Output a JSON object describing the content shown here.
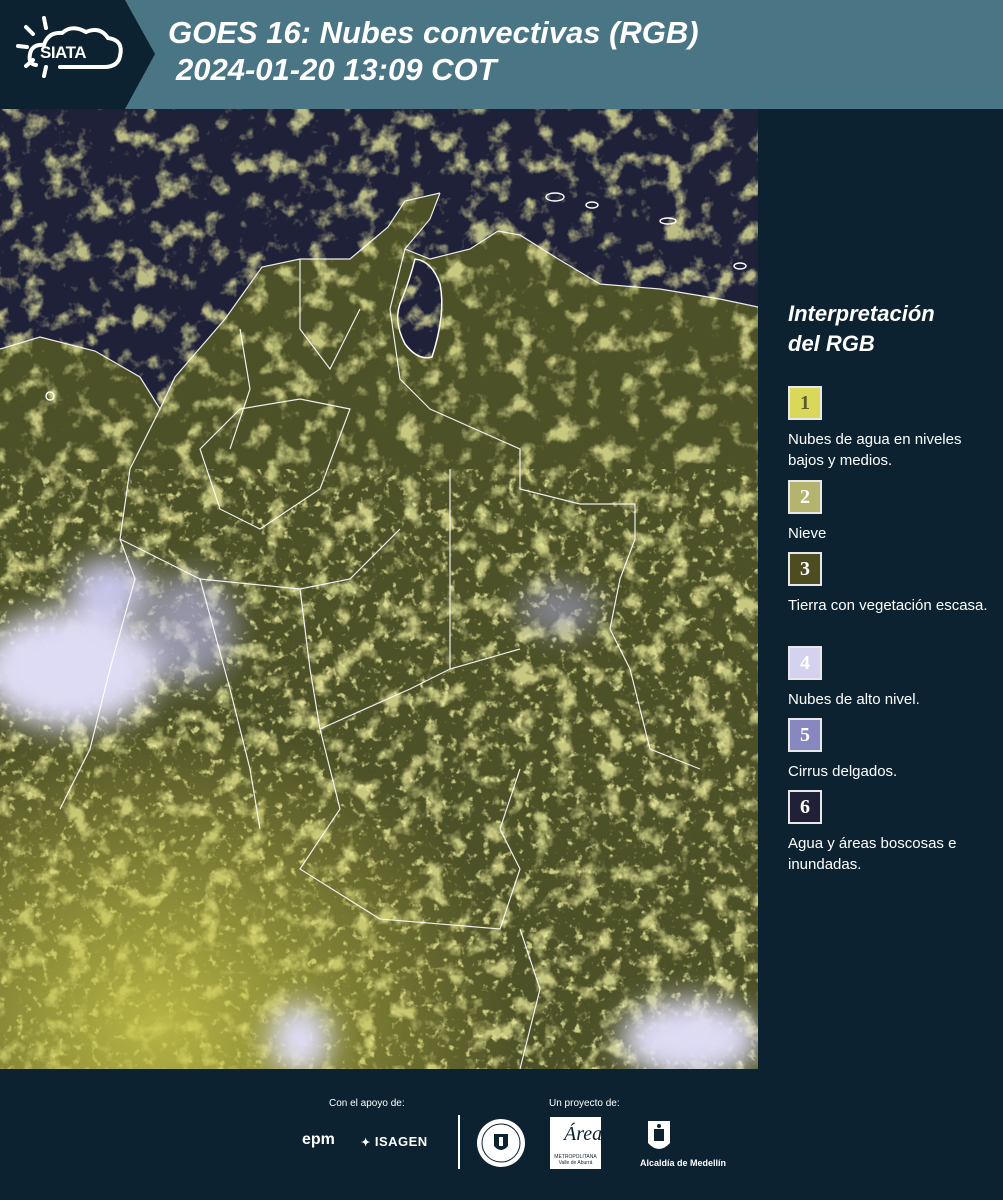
{
  "header": {
    "logo_text": "SIATA",
    "title_line1": "GOES 16: Nubes convectivas (RGB)",
    "title_line2": "2024-01-20 13:09 COT"
  },
  "map": {
    "icon": "satellite-image",
    "colors": {
      "ocean": "#1f2139",
      "land": "#4d5127",
      "low_clouds": "#e4e05a",
      "high_clouds": "#dcdcf2",
      "borders": "#ffffff"
    }
  },
  "legend": {
    "title_line1": "Interpretación",
    "title_line2": "del RGB",
    "items": [
      {
        "number": "1",
        "color": "#dad85a",
        "text_color": "#5a5a2a",
        "description": "Nubes de agua en niveles bajos y medios."
      },
      {
        "number": "2",
        "color": "#b4b46e",
        "text_color": "#ffffff",
        "description": "Nieve"
      },
      {
        "number": "3",
        "color": "#4e4d22",
        "text_color": "#ffffff",
        "description": "Tierra con vegetación escasa."
      },
      {
        "number": "4",
        "color": "#d4d2ef",
        "text_color": "#ffffff",
        "description": "Nubes de alto nivel."
      },
      {
        "number": "5",
        "color": "#8888c0",
        "text_color": "#ffffff",
        "description": "Cirrus delgados."
      },
      {
        "number": "6",
        "color": "#202036",
        "text_color": "#ffffff",
        "description": "Agua y áreas boscosas e inundadas."
      }
    ]
  },
  "footer": {
    "support_label": "Con el apoyo de:",
    "project_label": "Un proyecto de:",
    "sponsor1": "epm",
    "sponsor2": "ISAGEN",
    "partner_area": "Área",
    "partner_area_sub": "METROPOLITANA Valle de Aburrá",
    "partner_alcaldia": "Alcaldía de Medellín"
  }
}
